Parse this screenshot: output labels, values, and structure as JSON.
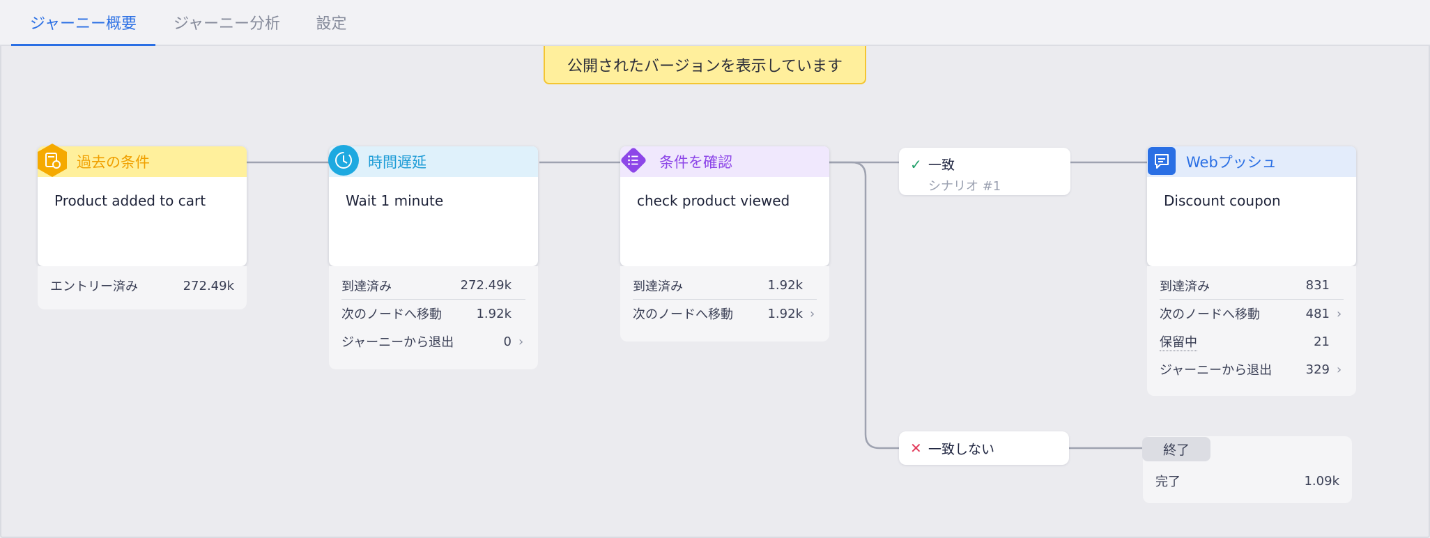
{
  "tabs": [
    {
      "label": "ジャーニー概要",
      "active": true
    },
    {
      "label": "ジャーニー分析",
      "active": false
    },
    {
      "label": "設定",
      "active": false
    }
  ],
  "banner": "公開されたバージョンを表示しています",
  "nodes": {
    "past_condition": {
      "title": "過去の条件",
      "body": "Product added to cart",
      "stats": [
        {
          "label": "エントリー済み",
          "value": "272.49k"
        }
      ]
    },
    "delay": {
      "title": "時間遅延",
      "body": "Wait 1 minute",
      "stats": [
        {
          "label": "到達済み",
          "value": "272.49k"
        },
        {
          "label": "次のノードへ移動",
          "value": "1.92k"
        },
        {
          "label": "ジャーニーから退出",
          "value": "0"
        }
      ]
    },
    "check": {
      "title": "条件を確認",
      "body": "check product viewed",
      "stats": [
        {
          "label": "到達済み",
          "value": "1.92k"
        },
        {
          "label": "次のノードへ移動",
          "value": "1.92k"
        }
      ]
    },
    "webpush": {
      "title": "Webプッシュ",
      "body": "Discount coupon",
      "stats": [
        {
          "label": "到達済み",
          "value": "831"
        },
        {
          "label": "次のノードへ移動",
          "value": "481"
        },
        {
          "label": "保留中",
          "value": "21"
        },
        {
          "label": "ジャーニーから退出",
          "value": "329"
        }
      ]
    }
  },
  "branches": {
    "match": {
      "label": "一致",
      "sub": "シナリオ #1"
    },
    "nomatch": {
      "label": "一致しない"
    }
  },
  "end": {
    "tag": "終了",
    "stats": [
      {
        "label": "完了",
        "value": "1.09k"
      }
    ]
  },
  "colors": {
    "past_condition": "#f5a900",
    "delay": "#1da9e0",
    "check": "#8d46e8",
    "webpush": "#2a6fe4",
    "accent": "#2a6fe4"
  },
  "icons": {
    "past_condition": "history-list-icon",
    "delay": "clock-icon",
    "check": "list-icon",
    "webpush": "chat-bubble-icon",
    "match": "check-icon",
    "nomatch": "x-icon",
    "chevron": "chevron-right-icon"
  }
}
